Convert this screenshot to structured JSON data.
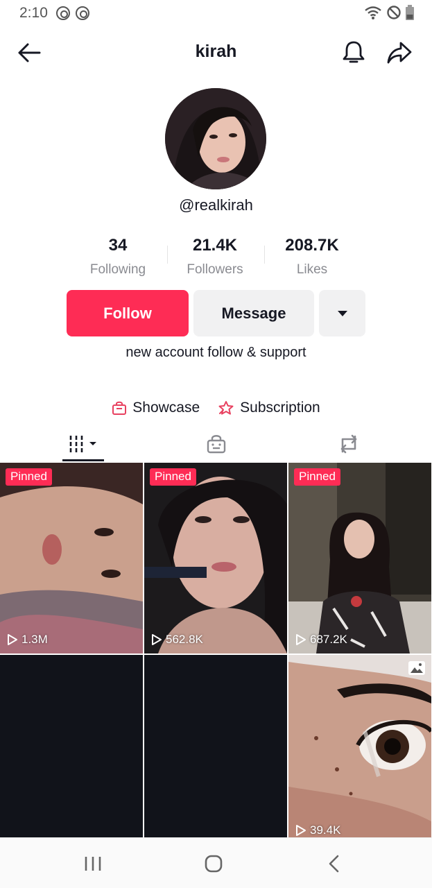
{
  "status_bar": {
    "time": "2:10"
  },
  "header": {
    "title": "kirah"
  },
  "profile": {
    "username": "@realkirah",
    "bio": "new account follow & support"
  },
  "stats": [
    {
      "value": "34",
      "label": "Following"
    },
    {
      "value": "21.4K",
      "label": "Followers"
    },
    {
      "value": "208.7K",
      "label": "Likes"
    }
  ],
  "buttons": {
    "follow": "Follow",
    "message": "Message"
  },
  "links": {
    "showcase": "Showcase",
    "subscription": "Subscription"
  },
  "tabs": [
    "videos-tab",
    "shop-tab",
    "reposts-tab"
  ],
  "videos": [
    {
      "pinned": "Pinned",
      "views": "1.3M"
    },
    {
      "pinned": "Pinned",
      "views": "562.8K"
    },
    {
      "pinned": "Pinned",
      "views": "687.2K"
    },
    {
      "views": ""
    },
    {
      "views": ""
    },
    {
      "views": "39.4K"
    }
  ],
  "colors": {
    "accent": "#fe2c55",
    "text": "#161823",
    "muted": "#8a8b91",
    "button_bg": "#f1f1f2"
  }
}
